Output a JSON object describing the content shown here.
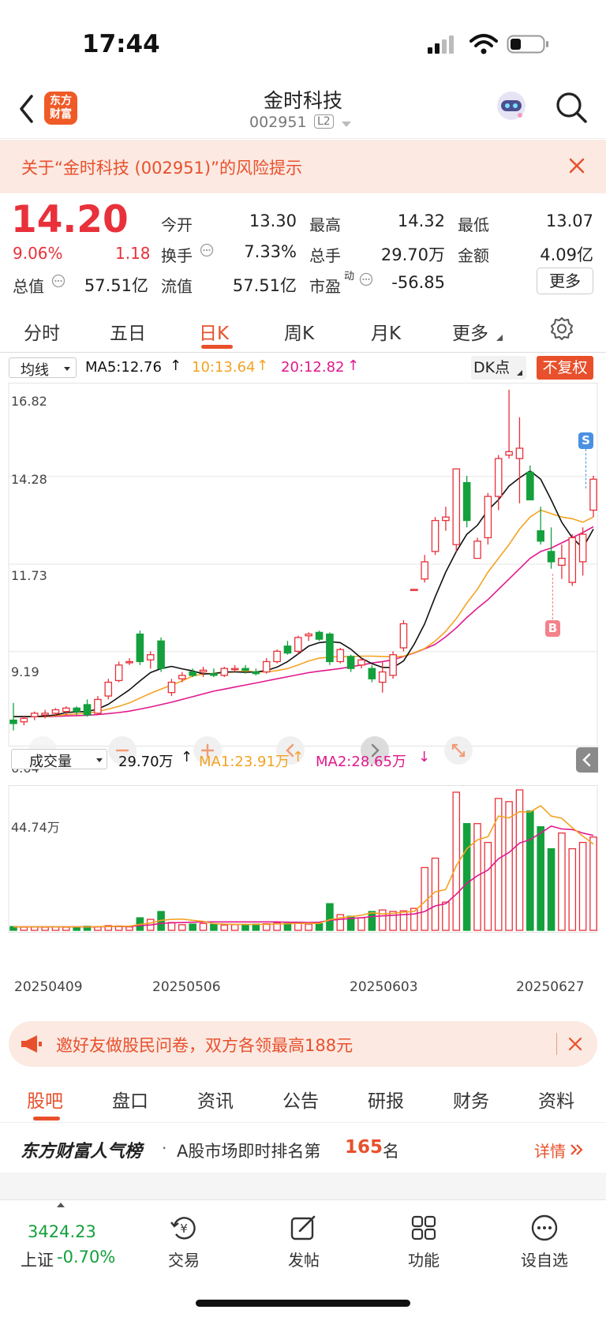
{
  "status_bar": {
    "time": "17:44"
  },
  "header": {
    "title": "金时科技",
    "code": "002951",
    "level_badge": "L2",
    "logo_text_1": "东方",
    "logo_text_2": "财富"
  },
  "risk_notice": {
    "text": "关于“金时科技 (002951)”的风险提示"
  },
  "quote": {
    "price": "14.20",
    "change_pct": "9.06%",
    "change": "1.18",
    "market_cap_label": "总值",
    "market_cap": "57.51亿",
    "fields": [
      {
        "label": "今开",
        "value": "13.30",
        "color": "#e8313a"
      },
      {
        "label": "最高",
        "value": "14.32",
        "color": "#e8313a"
      },
      {
        "label": "最低",
        "value": "13.07",
        "color": "#e8313a"
      },
      {
        "label": "换手",
        "value": "7.33%",
        "color": "#222"
      },
      {
        "label": "总手",
        "value": "29.70万",
        "color": "#222"
      },
      {
        "label": "金额",
        "value": "4.09亿",
        "color": "#222"
      },
      {
        "label": "流值",
        "value": "57.51亿",
        "color": "#222"
      },
      {
        "label": "市盈",
        "value": "-56.85",
        "color": "#222"
      }
    ],
    "pe_sup": "动",
    "more_button": "更多"
  },
  "tabs": {
    "items": [
      "分时",
      "五日",
      "日K",
      "周K",
      "月K",
      "更多"
    ],
    "active_index": 2
  },
  "chart_controls": {
    "ma_select": "均线",
    "ma5": "MA5:12.76",
    "ma10": "10:13.64",
    "ma20": "20:12.82",
    "dk_button": "DK点",
    "adjust_button": "不复权",
    "vol_select": "成交量",
    "vol_value": "29.70万",
    "vol_ma1": "MA1:23.91万",
    "vol_ma2": "MA2:28.65万",
    "marker_s": "S",
    "marker_b": "B"
  },
  "chart_data": {
    "type": "candlestick",
    "price_axis_labels": [
      "16.82",
      "14.28",
      "11.73",
      "9.19",
      "6.64"
    ],
    "price_range": [
      6.64,
      16.82
    ],
    "volume_axis_label": "44.74万",
    "volume_max": 44.74,
    "x_labels": [
      "20250409",
      "20250506",
      "20250603",
      "20250627"
    ],
    "candles": [
      [
        7.2,
        7.7,
        6.9,
        7.1
      ],
      [
        7.15,
        7.3,
        7.05,
        7.25
      ],
      [
        7.3,
        7.45,
        7.2,
        7.4
      ],
      [
        7.35,
        7.5,
        7.25,
        7.4
      ],
      [
        7.4,
        7.55,
        7.3,
        7.5
      ],
      [
        7.45,
        7.6,
        7.35,
        7.55
      ],
      [
        7.55,
        7.6,
        7.35,
        7.45
      ],
      [
        7.65,
        7.8,
        7.3,
        7.35
      ],
      [
        7.4,
        7.9,
        7.35,
        7.8
      ],
      [
        7.9,
        8.4,
        7.8,
        8.3
      ],
      [
        8.35,
        8.9,
        8.3,
        8.8
      ],
      [
        8.9,
        9.0,
        8.8,
        8.9
      ],
      [
        9.7,
        9.8,
        8.8,
        8.9
      ],
      [
        8.95,
        9.2,
        8.7,
        9.1
      ],
      [
        9.5,
        9.6,
        8.6,
        8.7
      ],
      [
        8.0,
        8.4,
        7.9,
        8.3
      ],
      [
        8.4,
        8.6,
        8.3,
        8.5
      ],
      [
        8.6,
        8.7,
        8.45,
        8.5
      ],
      [
        8.6,
        8.75,
        8.45,
        8.65
      ],
      [
        8.55,
        8.7,
        8.45,
        8.5
      ],
      [
        8.5,
        8.75,
        8.45,
        8.7
      ],
      [
        8.7,
        8.8,
        8.6,
        8.7
      ],
      [
        8.7,
        8.8,
        8.55,
        8.65
      ],
      [
        8.6,
        8.7,
        8.5,
        8.55
      ],
      [
        8.6,
        9.0,
        8.55,
        8.9
      ],
      [
        8.9,
        9.25,
        8.85,
        9.2
      ],
      [
        9.35,
        9.5,
        9.1,
        9.15
      ],
      [
        9.2,
        9.65,
        9.1,
        9.6
      ],
      [
        9.65,
        9.75,
        9.5,
        9.7
      ],
      [
        9.75,
        9.8,
        9.5,
        9.55
      ],
      [
        9.7,
        9.75,
        8.8,
        8.9
      ],
      [
        8.9,
        9.3,
        8.85,
        9.25
      ],
      [
        9.05,
        9.1,
        8.6,
        8.7
      ],
      [
        8.8,
        9.0,
        8.7,
        8.95
      ],
      [
        8.7,
        8.8,
        8.3,
        8.4
      ],
      [
        8.3,
        8.9,
        8.0,
        8.6
      ],
      [
        8.5,
        9.2,
        8.4,
        9.1
      ],
      [
        9.3,
        10.1,
        9.2,
        10.0
      ],
      [
        11.0,
        11.0,
        11.0,
        11.0
      ],
      [
        11.3,
        12.0,
        11.2,
        11.8
      ],
      [
        12.1,
        13.1,
        12.0,
        13.0
      ],
      [
        13.0,
        13.4,
        12.7,
        13.1
      ],
      [
        12.3,
        14.5,
        12.1,
        14.5
      ],
      [
        14.1,
        14.3,
        12.8,
        13.0
      ],
      [
        11.9,
        12.5,
        11.9,
        12.4
      ],
      [
        12.5,
        13.8,
        12.3,
        13.7
      ],
      [
        13.7,
        14.9,
        13.3,
        14.8
      ],
      [
        14.9,
        16.8,
        14.8,
        15.0
      ],
      [
        14.8,
        16.0,
        13.5,
        15.1
      ],
      [
        14.4,
        14.6,
        13.6,
        13.6
      ],
      [
        12.7,
        13.4,
        12.3,
        12.4
      ],
      [
        12.1,
        12.8,
        11.6,
        11.8
      ],
      [
        11.7,
        12.3,
        11.3,
        11.9
      ],
      [
        11.2,
        12.6,
        11.1,
        12.5
      ],
      [
        11.8,
        12.8,
        11.4,
        12.6
      ],
      [
        13.3,
        14.3,
        13.1,
        14.2
      ]
    ],
    "ma5": [
      7.3,
      7.3,
      7.3,
      7.32,
      7.35,
      7.42,
      7.44,
      7.45,
      7.52,
      7.66,
      7.87,
      8.08,
      8.34,
      8.58,
      8.7,
      8.76,
      8.69,
      8.63,
      8.54,
      8.55,
      8.6,
      8.6,
      8.59,
      8.6,
      8.64,
      8.74,
      8.9,
      9.12,
      9.35,
      9.45,
      9.48,
      9.45,
      9.26,
      9.0,
      8.84,
      8.73,
      8.73,
      8.92,
      9.4,
      10.0,
      10.78,
      11.5,
      12.1,
      12.6,
      12.86,
      13.3,
      13.6,
      14.0,
      14.24,
      14.44,
      14.2,
      13.6,
      12.95,
      12.5,
      12.2,
      12.75
    ],
    "ma10": [
      7.3,
      7.3,
      7.3,
      7.31,
      7.33,
      7.36,
      7.38,
      7.4,
      7.45,
      7.52,
      7.6,
      7.7,
      7.84,
      7.98,
      8.1,
      8.22,
      8.34,
      8.48,
      8.54,
      8.56,
      8.58,
      8.6,
      8.62,
      8.6,
      8.6,
      8.64,
      8.7,
      8.8,
      8.92,
      9.0,
      9.03,
      9.05,
      9.04,
      9.06,
      9.06,
      9.05,
      9.04,
      9.06,
      9.16,
      9.28,
      9.5,
      9.78,
      10.15,
      10.6,
      11.0,
      11.5,
      11.9,
      12.3,
      12.75,
      13.1,
      13.3,
      13.2,
      13.1,
      13.05,
      12.95,
      13.1
    ],
    "ma20": [
      7.3,
      7.3,
      7.3,
      7.3,
      7.31,
      7.32,
      7.33,
      7.34,
      7.36,
      7.39,
      7.42,
      7.46,
      7.52,
      7.58,
      7.65,
      7.72,
      7.8,
      7.88,
      7.96,
      8.04,
      8.1,
      8.16,
      8.22,
      8.28,
      8.34,
      8.4,
      8.46,
      8.52,
      8.58,
      8.62,
      8.66,
      8.7,
      8.75,
      8.8,
      8.86,
      8.9,
      8.95,
      9.05,
      9.15,
      9.27,
      9.4,
      9.62,
      9.88,
      10.18,
      10.45,
      10.7,
      11.0,
      11.3,
      11.6,
      11.9,
      12.1,
      12.2,
      12.35,
      12.5,
      12.65,
      12.82
    ],
    "volumes": [
      1.2,
      1.0,
      1.1,
      1.0,
      1.1,
      1.0,
      1.1,
      1.3,
      1.2,
      1.5,
      1.4,
      1.1,
      4.0,
      3.5,
      6.0,
      2.5,
      1.8,
      2.0,
      2.2,
      1.9,
      1.7,
      1.8,
      1.9,
      2.0,
      2.1,
      2.4,
      2.2,
      2.3,
      2.0,
      2.1,
      8.5,
      5.0,
      4.5,
      4.0,
      6.0,
      6.5,
      6.0,
      6.2,
      7.0,
      20.0,
      23.0,
      9.0,
      44.0,
      34.0,
      34.0,
      28.0,
      42.0,
      41.0,
      44.74,
      38.0,
      33.0,
      26.0,
      31.0,
      26.0,
      28.0,
      29.7
    ],
    "vol_ma1": [
      1.1,
      1.1,
      1.1,
      1.1,
      1.1,
      1.1,
      1.1,
      1.1,
      1.2,
      1.2,
      1.3,
      1.3,
      1.9,
      2.3,
      3.2,
      3.5,
      3.6,
      3.2,
      2.9,
      2.1,
      2.0,
      1.9,
      1.9,
      1.9,
      1.9,
      2.0,
      2.1,
      2.2,
      2.2,
      2.2,
      3.4,
      4.0,
      4.4,
      4.8,
      5.6,
      5.2,
      5.4,
      5.8,
      6.0,
      9.1,
      12.3,
      13.0,
      20.6,
      26.0,
      28.8,
      29.8,
      36.4,
      35.8,
      37.8,
      37.7,
      39.7,
      36.4,
      35.7,
      32.7,
      30.0,
      27.5
    ],
    "vol_ma2": [
      1.1,
      1.1,
      1.1,
      1.1,
      1.1,
      1.1,
      1.1,
      1.1,
      1.1,
      1.2,
      1.2,
      1.2,
      1.5,
      1.7,
      2.2,
      2.4,
      2.5,
      2.6,
      2.7,
      2.7,
      2.7,
      2.7,
      2.7,
      2.7,
      2.7,
      2.7,
      2.6,
      2.6,
      2.5,
      2.6,
      3.2,
      3.5,
      3.8,
      4.0,
      4.4,
      4.6,
      4.8,
      5.0,
      5.2,
      6.0,
      7.8,
      8.5,
      11.5,
      15.0,
      17.4,
      19.2,
      22.8,
      24.8,
      27.8,
      28.9,
      31.0,
      33.2,
      32.3,
      32.1,
      31.0,
      30.2
    ]
  },
  "promo_banner": {
    "text": "邀好友做股民问卷，双方各领最高188元"
  },
  "sub_tabs": {
    "items": [
      "股吧",
      "盘口",
      "资讯",
      "公告",
      "研报",
      "财务",
      "资料"
    ],
    "active_index": 0
  },
  "rank": {
    "brand": "东方财富人气榜",
    "dot": "·",
    "prefix": "A股市场即时排名第",
    "rank": "165",
    "suffix": "名",
    "detail": "详情"
  },
  "bottom_nav": {
    "index_value": "3424.23",
    "index_name": "上证",
    "index_change": "-0.70%",
    "items": [
      "交易",
      "发帖",
      "功能",
      "设自选"
    ]
  }
}
